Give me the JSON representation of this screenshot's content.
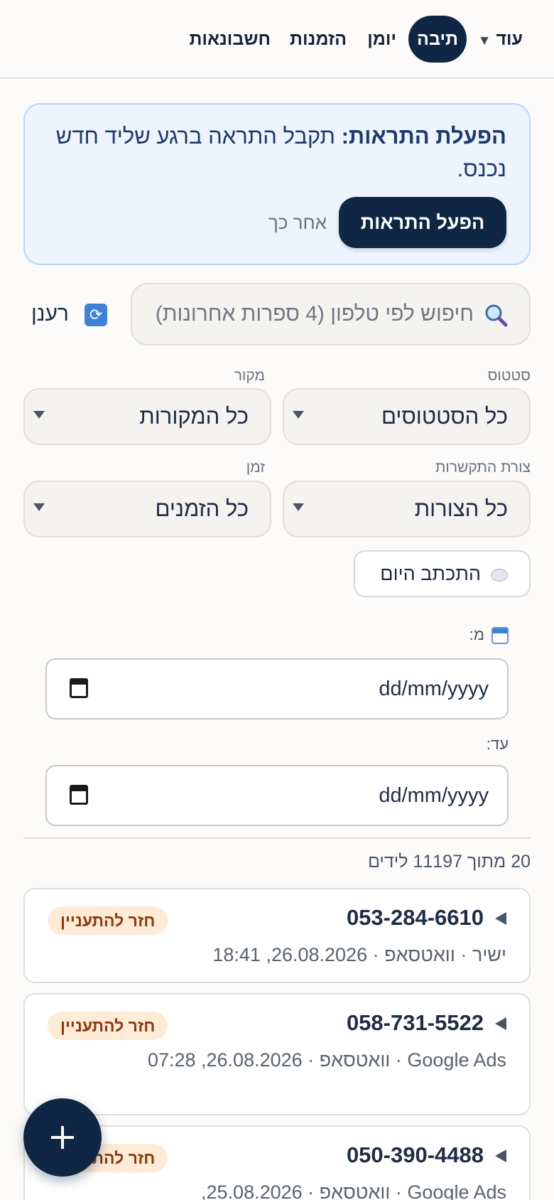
{
  "nav": {
    "more": "עוד",
    "inbox": "תיבה",
    "calendar": "יומן",
    "orders": "הזמנות",
    "invoices": "חשבונאות"
  },
  "notification": {
    "title": "הפעלת התראות:",
    "text": "תקבל התראה ברגע שליד חדש נכנס.",
    "enable_button": "הפעל התראות",
    "later_button": "אחר כך"
  },
  "search": {
    "placeholder": "חיפוש לפי טלפון (4 ספרות אחרונות)",
    "refresh_label": "רענן"
  },
  "filters": {
    "status": {
      "label": "סטטוס",
      "value": "כל הסטטוסים"
    },
    "source": {
      "label": "מקור",
      "value": "כל המקורות"
    },
    "contact": {
      "label": "צורת התקשרות",
      "value": "כל הצורות"
    },
    "time": {
      "label": "זמן",
      "value": "כל הזמנים"
    },
    "written_today": "התכתב היום"
  },
  "date_range": {
    "from_label": "מ:",
    "from_value": "dd/mm/yyyy",
    "to_label": "עד:",
    "to_value": "dd/mm/yyyy"
  },
  "results_count": "20 מתוך 11197 לידים",
  "leads": [
    {
      "phone": "053-284-6610",
      "meta": "ישיר · וואטסאפ · 26.08.2026, 18:41",
      "status": "חזר להתעניין"
    },
    {
      "phone": "058-731-5522",
      "meta": "Google Ads · וואטסאפ · 26.08.2026, 07:28",
      "status": "חזר להתעניין"
    },
    {
      "phone": "050-390-4488",
      "meta": "Google Ads · וואטסאפ · 25.08.2026,",
      "status": "חזר להתעניין"
    }
  ],
  "colors": {
    "primary": "#0f2744",
    "badge_bg": "#fdebd6",
    "badge_text": "#8a3b12",
    "notice_bg": "#edf4fd"
  }
}
